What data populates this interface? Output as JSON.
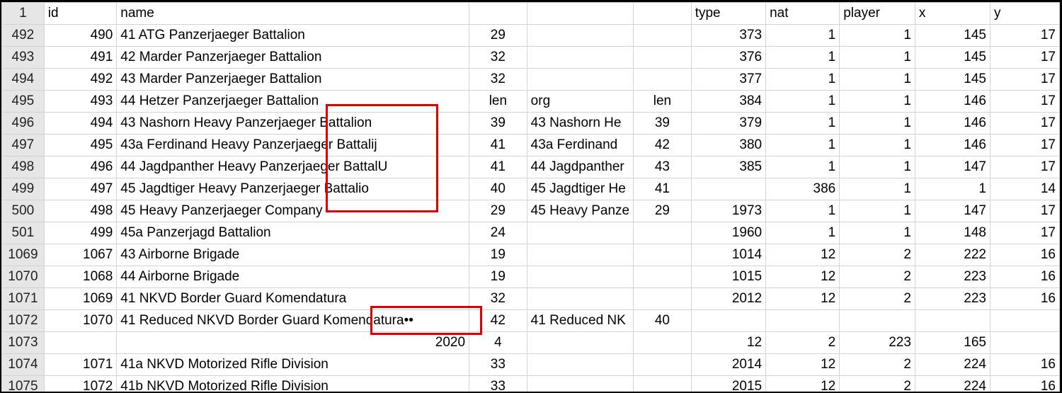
{
  "header_row": {
    "row_number": "1",
    "cells": [
      "id",
      "name",
      "",
      "",
      "",
      "type",
      "nat",
      "player",
      "x",
      "y"
    ]
  },
  "rows": [
    {
      "rn": "492",
      "c": [
        "490",
        "41 ATG Panzerjaeger Battalion",
        "29",
        "",
        "",
        "373",
        "1",
        "1",
        "145",
        "17"
      ]
    },
    {
      "rn": "493",
      "c": [
        "491",
        "42 Marder Panzerjaeger Battalion",
        "32",
        "",
        "",
        "376",
        "1",
        "1",
        "145",
        "17"
      ]
    },
    {
      "rn": "494",
      "c": [
        "492",
        "43 Marder Panzerjaeger Battalion",
        "32",
        "",
        "",
        "377",
        "1",
        "1",
        "145",
        "17"
      ]
    },
    {
      "rn": "495",
      "c": [
        "493",
        "44 Hetzer Panzerjaeger Battalion",
        "len",
        "org",
        "len",
        "384",
        "1",
        "1",
        "146",
        "17"
      ]
    },
    {
      "rn": "496",
      "c": [
        "494",
        "43 Nashorn Heavy Panzerjaeger Battalion",
        "39",
        "43 Nashorn He",
        "39",
        "379",
        "1",
        "1",
        "146",
        "17"
      ]
    },
    {
      "rn": "497",
      "c": [
        "495",
        "43a Ferdinand Heavy Panzerjaeger Battalij",
        "41",
        "43a Ferdinand",
        "42",
        "380",
        "1",
        "1",
        "146",
        "17"
      ]
    },
    {
      "rn": "498",
      "c": [
        "496",
        "44 Jagdpanther Heavy Panzerjaeger BattalU",
        "41",
        "44 Jagdpanther",
        "43",
        "385",
        "1",
        "1",
        "147",
        "17"
      ]
    },
    {
      "rn": "499",
      "c": [
        "497",
        "45 Jagdtiger Heavy Panzerjaeger Battalio",
        "40",
        "45 Jagdtiger He",
        "41",
        "",
        "386",
        "1",
        "1",
        "14"
      ]
    },
    {
      "rn": "500",
      "c": [
        "498",
        "45 Heavy Panzerjaeger Company",
        "29",
        "45 Heavy Panze",
        "29",
        "1973",
        "1",
        "1",
        "147",
        "17"
      ]
    },
    {
      "rn": "501",
      "c": [
        "499",
        "45a Panzerjagd Battalion",
        "24",
        "",
        "",
        "1960",
        "1",
        "1",
        "148",
        "17"
      ]
    },
    {
      "rn": "1069",
      "c": [
        "1067",
        "43 Airborne Brigade",
        "19",
        "",
        "",
        "1014",
        "12",
        "2",
        "222",
        "16"
      ]
    },
    {
      "rn": "1070",
      "c": [
        "1068",
        "44 Airborne Brigade",
        "19",
        "",
        "",
        "1015",
        "12",
        "2",
        "223",
        "16"
      ]
    },
    {
      "rn": "1071",
      "c": [
        "1069",
        "41 NKVD Border Guard Komendatura",
        "32",
        "",
        "",
        "2012",
        "12",
        "2",
        "223",
        "16"
      ]
    },
    {
      "rn": "1072",
      "c": [
        "1070",
        "41 Reduced NKVD Border Guard Komendatura••",
        "42",
        "41 Reduced NK",
        "40",
        "",
        "",
        "",
        "",
        ""
      ]
    },
    {
      "rn": "1073",
      "c": [
        "",
        "2020",
        "4",
        "",
        "",
        "12",
        "2",
        "223",
        "165",
        ""
      ]
    },
    {
      "rn": "1074",
      "c": [
        "1071",
        "41a NKVD Motorized Rifle Division",
        "33",
        "",
        "",
        "2014",
        "12",
        "2",
        "224",
        "16"
      ]
    },
    {
      "rn": "1075",
      "c": [
        "1072",
        "41b NKVD Motorized Rifle Division",
        "33",
        "",
        "",
        "2015",
        "12",
        "2",
        "224",
        "16"
      ]
    }
  ],
  "highlight_color": "#e00000"
}
